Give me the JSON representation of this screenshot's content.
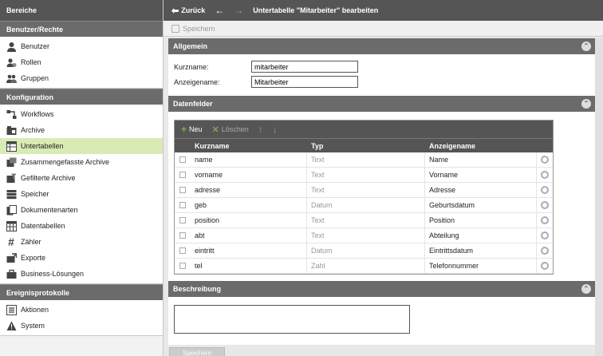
{
  "sidebar": {
    "header": "Bereiche",
    "sections": [
      {
        "title": "Benutzer/Rechte",
        "items": [
          {
            "label": "Benutzer",
            "icon": "user-icon"
          },
          {
            "label": "Rollen",
            "icon": "role-icon"
          },
          {
            "label": "Gruppen",
            "icon": "group-icon"
          }
        ]
      },
      {
        "title": "Konfiguration",
        "items": [
          {
            "label": "Workflows",
            "icon": "workflow-icon"
          },
          {
            "label": "Archive",
            "icon": "archive-icon"
          },
          {
            "label": "Untertabellen",
            "icon": "subtable-icon"
          },
          {
            "label": "Zusammengefasste Archive",
            "icon": "merged-archive-icon"
          },
          {
            "label": "Gefilterte Archive",
            "icon": "filtered-archive-icon"
          },
          {
            "label": "Speicher",
            "icon": "storage-icon"
          },
          {
            "label": "Dokumentenarten",
            "icon": "document-types-icon"
          },
          {
            "label": "Datentabellen",
            "icon": "data-table-icon"
          },
          {
            "label": "Zähler",
            "icon": "counter-icon"
          },
          {
            "label": "Exporte",
            "icon": "export-icon"
          },
          {
            "label": "Business-Lösungen",
            "icon": "business-icon"
          }
        ]
      },
      {
        "title": "Ereignisprotokolle",
        "items": [
          {
            "label": "Aktionen",
            "icon": "actions-icon"
          },
          {
            "label": "System",
            "icon": "warning-icon"
          }
        ]
      }
    ],
    "active": "Untertabellen"
  },
  "topbar": {
    "back_label": "Zurück",
    "title": "Untertabelle \"Mitarbeiter\" bearbeiten"
  },
  "toolbar": {
    "save_label": "Speichern"
  },
  "allgemein": {
    "title": "Allgemein",
    "kurzname_label": "Kurzname:",
    "kurzname_value": "mitarbeiter",
    "anzeigename_label": "Anzeigename:",
    "anzeigename_value": "Mitarbeiter"
  },
  "datenfelder": {
    "title": "Datenfelder",
    "new_label": "Neu",
    "delete_label": "Löschen",
    "columns": [
      "Kurzname",
      "Typ",
      "Anzeigename"
    ],
    "rows": [
      {
        "kurzname": "name",
        "typ": "Text",
        "anzeigename": "Name"
      },
      {
        "kurzname": "vorname",
        "typ": "Text",
        "anzeigename": "Vorname"
      },
      {
        "kurzname": "adresse",
        "typ": "Text",
        "anzeigename": "Adresse"
      },
      {
        "kurzname": "geb",
        "typ": "Datum",
        "anzeigename": "Geburtsdatum"
      },
      {
        "kurzname": "position",
        "typ": "Text",
        "anzeigename": "Position"
      },
      {
        "kurzname": "abt",
        "typ": "Text",
        "anzeigename": "Abteilung"
      },
      {
        "kurzname": "eintritt",
        "typ": "Datum",
        "anzeigename": "Eintrittsdatum"
      },
      {
        "kurzname": "tel",
        "typ": "Zahl",
        "anzeigename": "Telefonnummer"
      }
    ]
  },
  "beschreibung": {
    "title": "Beschreibung"
  },
  "footer": {
    "save_label": "Speichern"
  },
  "colors": {
    "active_bg": "#d8ebb5",
    "accent_green": "#7cb342",
    "header_gray": "#555555"
  }
}
